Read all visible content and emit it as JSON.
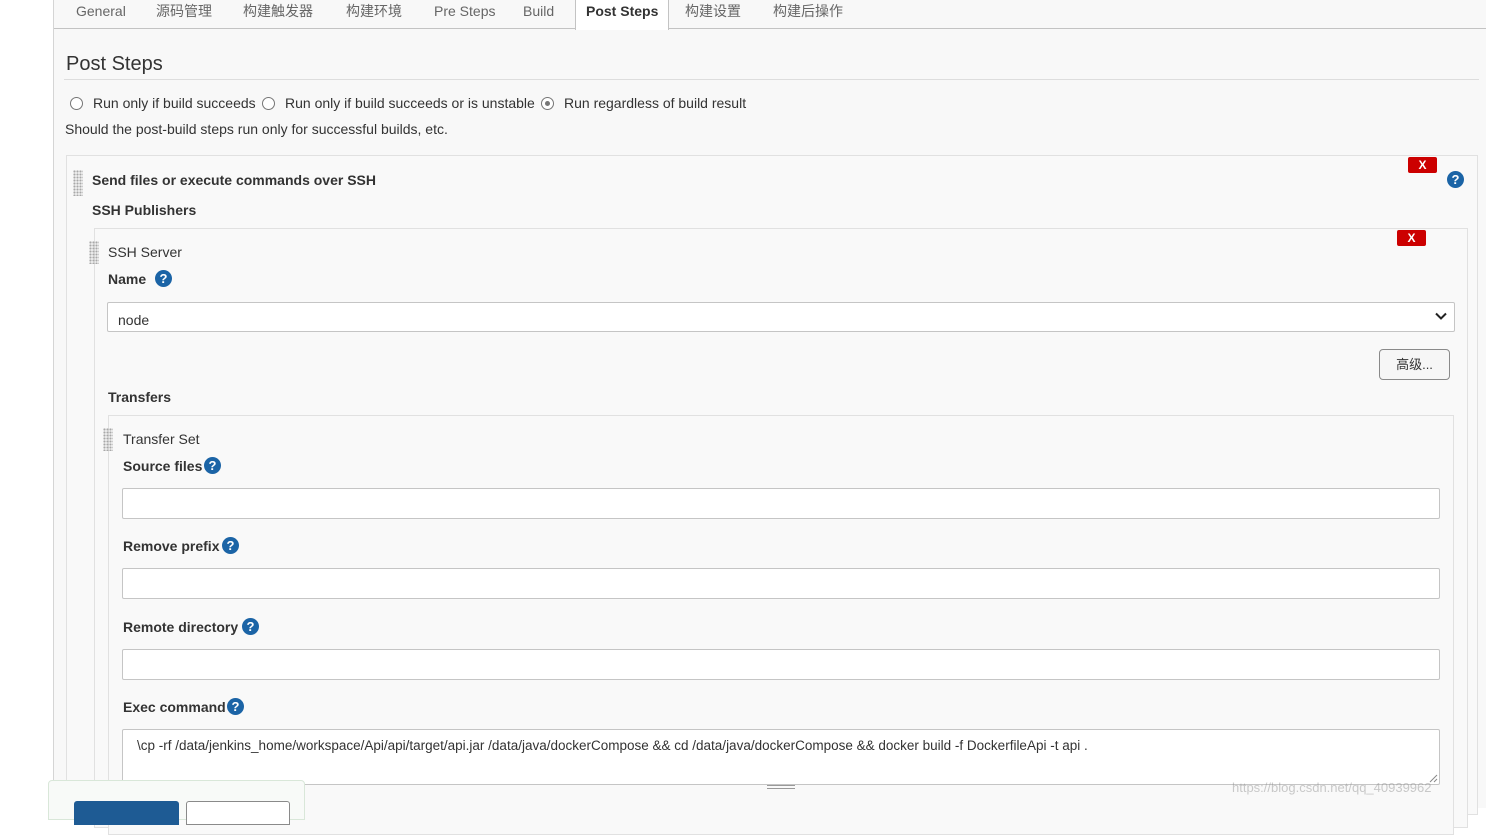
{
  "tabs": [
    {
      "label": "General"
    },
    {
      "label": "源码管理"
    },
    {
      "label": "构建触发器"
    },
    {
      "label": "构建环境"
    },
    {
      "label": "Pre Steps"
    },
    {
      "label": "Build"
    },
    {
      "label": "Post Steps",
      "active": true
    },
    {
      "label": "构建设置"
    },
    {
      "label": "构建后操作"
    }
  ],
  "post_steps": {
    "title": "Post Steps",
    "options": [
      {
        "label": "Run only if build succeeds",
        "selected": false
      },
      {
        "label": "Run only if build succeeds or is unstable",
        "selected": false
      },
      {
        "label": "Run regardless of build result",
        "selected": true
      }
    ],
    "description": "Should the post-build steps run only for successful builds, etc."
  },
  "ssh_step": {
    "title": "Send files or execute commands over SSH",
    "delete_label": "X",
    "publishers_label": "SSH Publishers",
    "server": {
      "title": "SSH Server",
      "delete_label": "X",
      "name_label": "Name",
      "name_value": "node",
      "advanced_label": "高级...",
      "transfers_label": "Transfers",
      "transfer_set": {
        "title": "Transfer Set",
        "source_files_label": "Source files",
        "source_files_value": "",
        "remove_prefix_label": "Remove prefix",
        "remove_prefix_value": "",
        "remote_directory_label": "Remote directory",
        "remote_directory_value": "",
        "exec_command_label": "Exec command",
        "exec_command_value": "\\cp -rf  /data/jenkins_home/workspace/Api/api/target/api.jar  /data/java/dockerCompose  && cd  /data/java/dockerCompose  &&  docker build -f DockerfileApi -t api ."
      }
    }
  },
  "help_glyph": "?",
  "watermark": "https://blog.csdn.net/qq_40939962",
  "colors": {
    "accent_blue": "#1b64a6",
    "delete_red": "#cc0000",
    "save_button": "#1e5b94"
  }
}
